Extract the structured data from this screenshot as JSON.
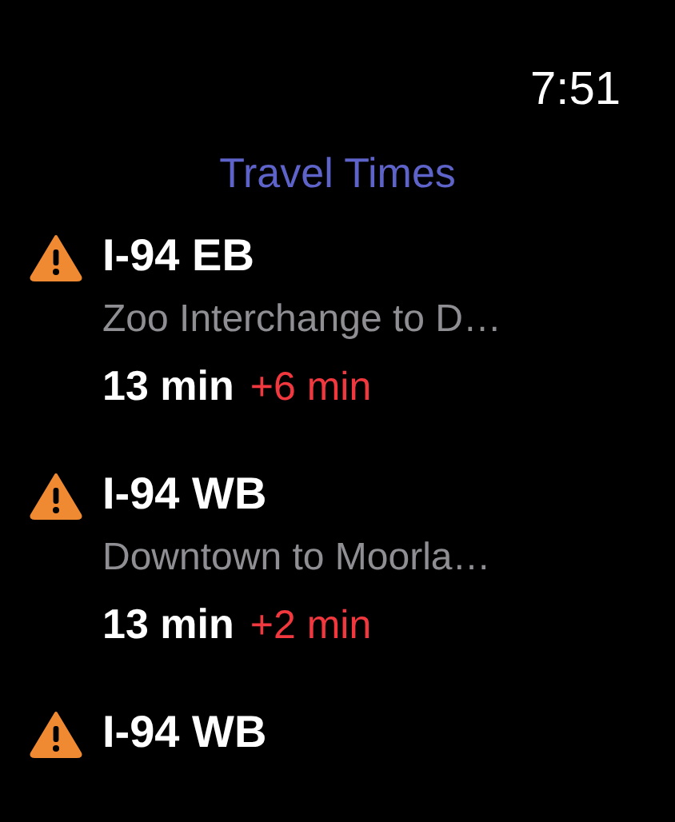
{
  "status_bar": {
    "time": "7:51"
  },
  "title": "Travel Times",
  "routes": [
    {
      "name": "I-94 EB",
      "description": "Zoo Interchange to D…",
      "time": "13 min",
      "delay": "+6 min",
      "alert": true
    },
    {
      "name": "I-94 WB",
      "description": "Downtown to Moorla…",
      "time": "13 min",
      "delay": "+2 min",
      "alert": true
    },
    {
      "name": "I-94 WB",
      "alert": true
    }
  ]
}
